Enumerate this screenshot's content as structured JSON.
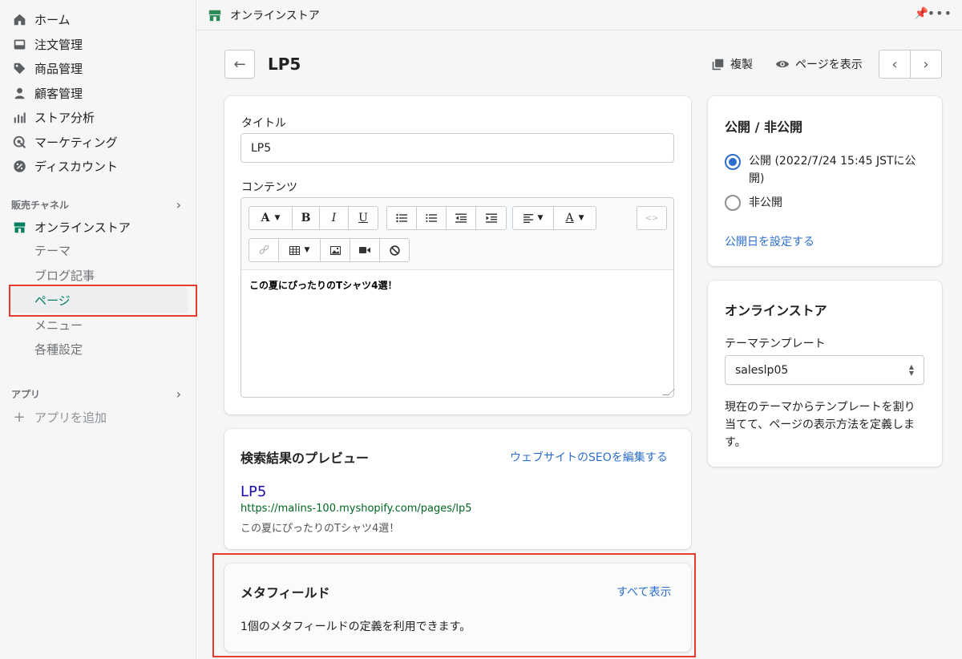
{
  "sidebar": {
    "main_items": [
      {
        "label": "ホーム",
        "icon": "home-icon"
      },
      {
        "label": "注文管理",
        "icon": "orders-icon"
      },
      {
        "label": "商品管理",
        "icon": "tag-icon"
      },
      {
        "label": "顧客管理",
        "icon": "person-icon"
      },
      {
        "label": "ストア分析",
        "icon": "bar-chart-icon"
      },
      {
        "label": "マーケティング",
        "icon": "target-icon"
      },
      {
        "label": "ディスカウント",
        "icon": "discount-icon"
      }
    ],
    "sales_channels_heading": "販売チャネル",
    "online_store_label": "オンラインストア",
    "online_store_sub": [
      "テーマ",
      "ブログ記事",
      "ページ",
      "メニュー",
      "各種設定"
    ],
    "active_sub": "ページ",
    "apps_heading": "アプリ",
    "add_app_label": "アプリを追加"
  },
  "topbar": {
    "title": "オンラインストア"
  },
  "header": {
    "page_title": "LP5",
    "duplicate_label": "複製",
    "view_page_label": "ページを表示"
  },
  "content_card": {
    "title_label": "タイトル",
    "title_value": "LP5",
    "content_label": "コンテンツ",
    "editor_text": "この夏にぴったりのTシャツ4選！"
  },
  "seo_card": {
    "heading": "検索結果のプレビュー",
    "edit_link": "ウェブサイトのSEOを編集する",
    "preview_title": "LP5",
    "preview_url": "https://malins-100.myshopify.com/pages/lp5",
    "preview_description": "この夏にぴったりのTシャツ4選！"
  },
  "metafield_card": {
    "heading": "メタフィールド",
    "show_all_link": "すべて表示",
    "description": "1個のメタフィールドの定義を利用できます。"
  },
  "visibility_card": {
    "heading": "公開 / 非公開",
    "visible_label": "公開 (2022/7/24 15:45 JSTに公開)",
    "hidden_label": "非公開",
    "selected": "visible",
    "set_date_link": "公開日を設定する"
  },
  "online_store_card": {
    "heading": "オンラインストア",
    "template_label": "テーマテンプレート",
    "template_value": "saleslp05",
    "help_text": "現在のテーマからテンプレートを割り当てて、ページの表示方法を定義します。"
  },
  "colors": {
    "accent": "#2c6ecb",
    "active_nav": "#008060",
    "highlight": "#e63a2e"
  }
}
